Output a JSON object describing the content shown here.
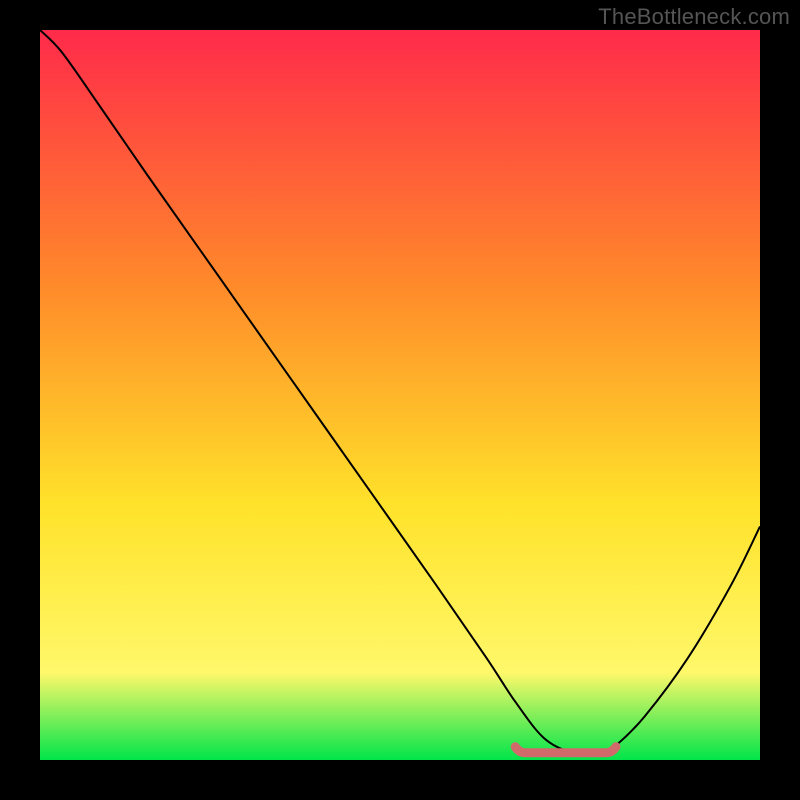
{
  "watermark": "TheBottleneck.com",
  "colors": {
    "bg": "#000000",
    "grad_top": "#ff2a4a",
    "grad_mid1": "#ff8a2a",
    "grad_mid2": "#ffe22a",
    "grad_low": "#fff86a",
    "grad_bottom": "#00e54a",
    "curve": "#000000",
    "band": "#d16a6a"
  },
  "chart_data": {
    "type": "line",
    "title": "",
    "xlabel": "",
    "ylabel": "",
    "xlim": [
      0,
      100
    ],
    "ylim": [
      0,
      100
    ],
    "x": [
      0,
      3,
      8,
      15,
      25,
      35,
      45,
      55,
      62,
      66,
      70,
      74,
      78,
      80,
      84,
      90,
      96,
      100
    ],
    "y": [
      100,
      97,
      90,
      80,
      66,
      52,
      38,
      24,
      14,
      8,
      3,
      1,
      1,
      2,
      6,
      14,
      24,
      32
    ],
    "optimal_band": {
      "x_start": 66,
      "x_end": 80,
      "y": 1
    },
    "notes": "V-shaped bottleneck curve; y≈0 at optimum band, rises toward both extremes; left side reaches ~100% at x=0, right side ~32% at x=100."
  }
}
